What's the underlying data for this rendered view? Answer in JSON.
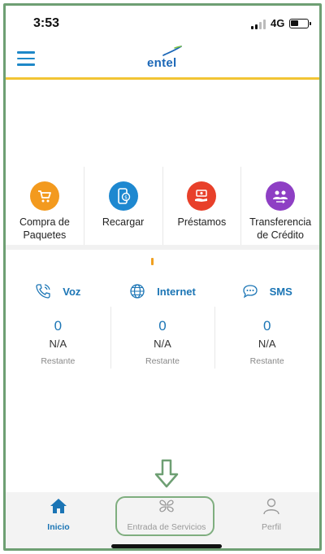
{
  "status_bar": {
    "time": "3:53",
    "network": "4G",
    "battery_fraction": 0.45
  },
  "header": {
    "logo_text": "entel",
    "brand_color": "#1b67b7",
    "accent_color": "#f2c434"
  },
  "shortcuts": [
    {
      "label": "Compra de Paquetes",
      "icon": "cart-icon",
      "color": "#f39a1e"
    },
    {
      "label": "Recargar",
      "icon": "phone-dollar-icon",
      "color": "#1e88d0"
    },
    {
      "label": "Préstamos",
      "icon": "money-hand-icon",
      "color": "#e8402a"
    },
    {
      "label": "Transferencia de Crédito",
      "icon": "users-transfer-icon",
      "color": "#8e3fc4"
    }
  ],
  "balances": [
    {
      "title": "Voz",
      "icon": "phone-call-icon",
      "value": "0",
      "unit": "N/A",
      "caption": "Restante"
    },
    {
      "title": "Internet",
      "icon": "globe-icon",
      "value": "0",
      "unit": "N/A",
      "caption": "Restante"
    },
    {
      "title": "SMS",
      "icon": "chat-bubble-icon",
      "value": "0",
      "unit": "N/A",
      "caption": "Restante"
    }
  ],
  "bottom_nav": {
    "inicio": "Inicio",
    "servicios": "Entrada de Servicios",
    "perfil": "Perfil"
  }
}
